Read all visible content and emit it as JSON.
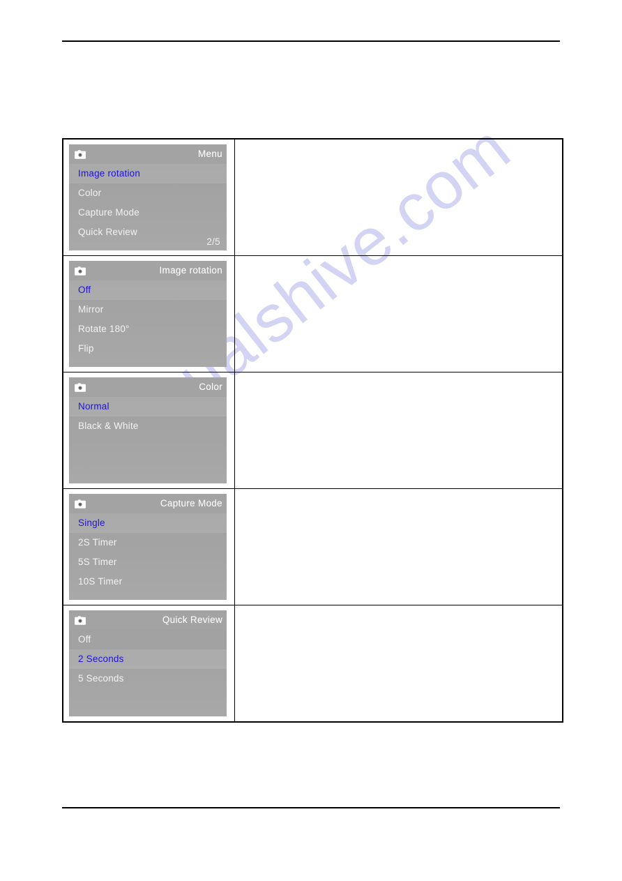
{
  "watermark": {
    "text": "manualshive.com",
    "color": "#ccccf2"
  },
  "colors": {
    "screen_background": "#a3a3a3",
    "item_text": "#f2f2f2",
    "selected_text": "#2211dd",
    "title_text": "#ffffff",
    "rule": "#000000"
  },
  "table": {
    "rows": [
      {
        "screen": {
          "icon": "camera-icon",
          "title": "Menu",
          "items": [
            {
              "label": "Image rotation",
              "selected": true
            },
            {
              "label": "Color",
              "selected": false
            },
            {
              "label": "Capture Mode",
              "selected": false
            },
            {
              "label": "Quick Review",
              "selected": false
            }
          ],
          "page_indicator": "2/5"
        },
        "description": ""
      },
      {
        "screen": {
          "icon": "camera-icon",
          "title": "Image rotation",
          "items": [
            {
              "label": "Off",
              "selected": true
            },
            {
              "label": "Mirror",
              "selected": false
            },
            {
              "label": "Rotate 180°",
              "selected": false
            },
            {
              "label": "Flip",
              "selected": false
            }
          ],
          "page_indicator": ""
        },
        "description": ""
      },
      {
        "screen": {
          "icon": "camera-icon",
          "title": "Color",
          "items": [
            {
              "label": "Normal",
              "selected": true
            },
            {
              "label": "Black & White",
              "selected": false
            }
          ],
          "page_indicator": ""
        },
        "description": ""
      },
      {
        "screen": {
          "icon": "camera-icon",
          "title": "Capture Mode",
          "items": [
            {
              "label": "Single",
              "selected": true
            },
            {
              "label": "2S Timer",
              "selected": false
            },
            {
              "label": "5S Timer",
              "selected": false
            },
            {
              "label": "10S Timer",
              "selected": false
            }
          ],
          "page_indicator": ""
        },
        "description": ""
      },
      {
        "screen": {
          "icon": "camera-icon",
          "title": "Quick Review",
          "items": [
            {
              "label": "Off",
              "selected": false
            },
            {
              "label": "2 Seconds",
              "selected": true
            },
            {
              "label": "5 Seconds",
              "selected": false
            }
          ],
          "page_indicator": ""
        },
        "description": ""
      }
    ]
  }
}
